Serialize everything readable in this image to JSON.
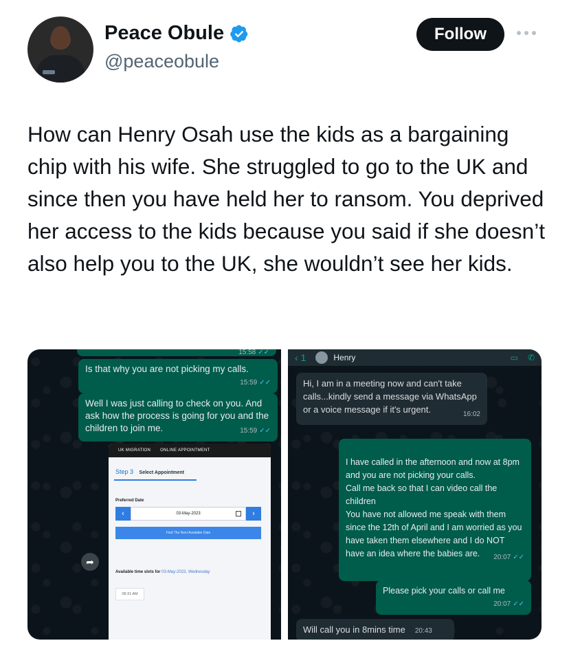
{
  "author": {
    "name": "Peace Obule",
    "handle": "@peaceobule",
    "follow_label": "Follow"
  },
  "tweet": {
    "text": "How can Henry Osah use the kids as a bargaining chip with his wife. She struggled to go to the UK and since then you have held her to ransom. You deprived her access to the kids because you said if she doesn’t also help you to the UK, she wouldn’t see her kids."
  },
  "media_left": {
    "top_time": "15:58",
    "bubble1": {
      "text": "Is that why you are not picking my calls.",
      "time": "15:59"
    },
    "bubble2": {
      "text": "Well I was just calling to check on you. And ask how the process is going for you and the children to join me.",
      "time": "15:59"
    },
    "screenshot": {
      "header_left": "UK MIGRATION",
      "header_right": "ONLINE APPOINTMENT",
      "step_number": "Step 3",
      "step_label": "Select Appointment",
      "preferred_label": "Preferred Date",
      "date_value": "03-May-2023",
      "find_label": "Find The Next Available Date",
      "available_label": "Available time slots for",
      "available_date": "03-May-2023, Wednesday",
      "slot": "08:31 AM"
    }
  },
  "media_right": {
    "contact": "Henry",
    "back_label": "1",
    "msg1": {
      "text": "Hi, I am in a meeting now and can't take calls...kindly send a message via WhatsApp or a voice message if it's urgent.",
      "time": "16:02"
    },
    "msg2": {
      "text": "I have called in the afternoon and now at 8pm and you are not picking your calls.\nCall me back so that I can video call the children\nYou have not allowed me speak with them since the 12th of April and I am worried as you have taken them elsewhere and I do NOT have an idea where the babies are.",
      "time": "20:07"
    },
    "msg3": {
      "text": "Please pick your calls or call me",
      "time": "20:07"
    },
    "msg4": {
      "text": "Will call you in 8mins time",
      "time": "20:43"
    }
  }
}
